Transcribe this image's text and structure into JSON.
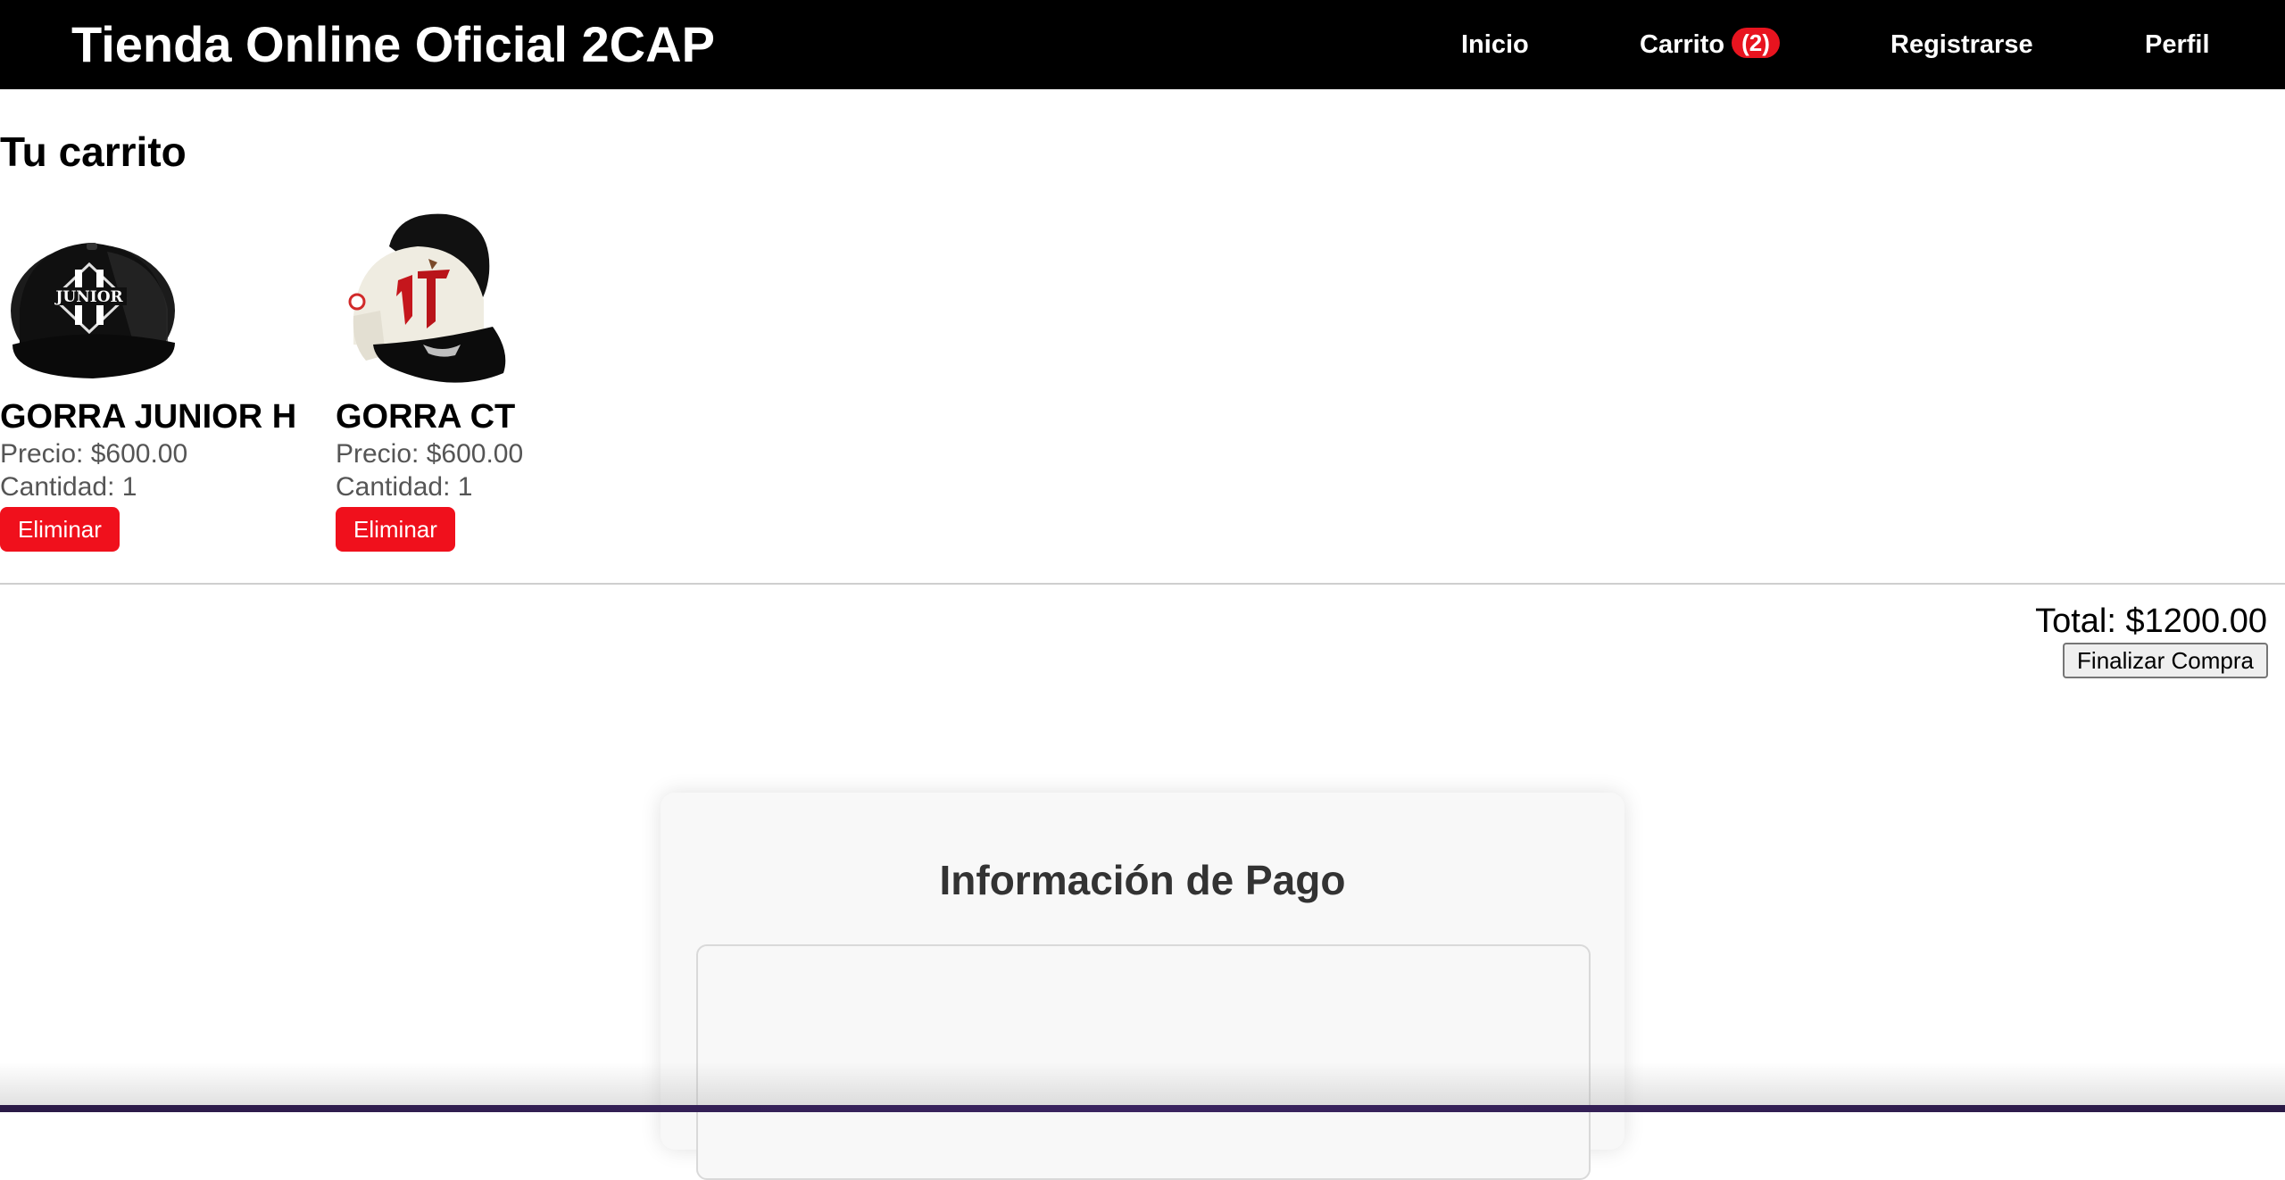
{
  "header": {
    "brand": "Tienda Online Oficial 2CAP",
    "nav": {
      "inicio": "Inicio",
      "carrito": "Carrito",
      "carrito_count": "(2)",
      "registrarse": "Registrarse",
      "perfil": "Perfil"
    }
  },
  "cart": {
    "title": "Tu carrito",
    "items": [
      {
        "name": "GORRA JUNIOR H",
        "price": "Precio: $600.00",
        "quantity": "Cantidad: 1",
        "remove_label": "Eliminar",
        "image_text": "JUNIOR"
      },
      {
        "name": "GORRA CT",
        "price": "Precio: $600.00",
        "quantity": "Cantidad: 1",
        "remove_label": "Eliminar"
      }
    ],
    "total": "Total: $1200.00",
    "checkout_label": "Finalizar Compra"
  },
  "payment": {
    "title": "Información de Pago"
  },
  "colors": {
    "header_bg": "#000000",
    "badge_bg": "#e8141f",
    "remove_button_bg": "#f0101c",
    "card_bg": "#f8f8f8"
  }
}
